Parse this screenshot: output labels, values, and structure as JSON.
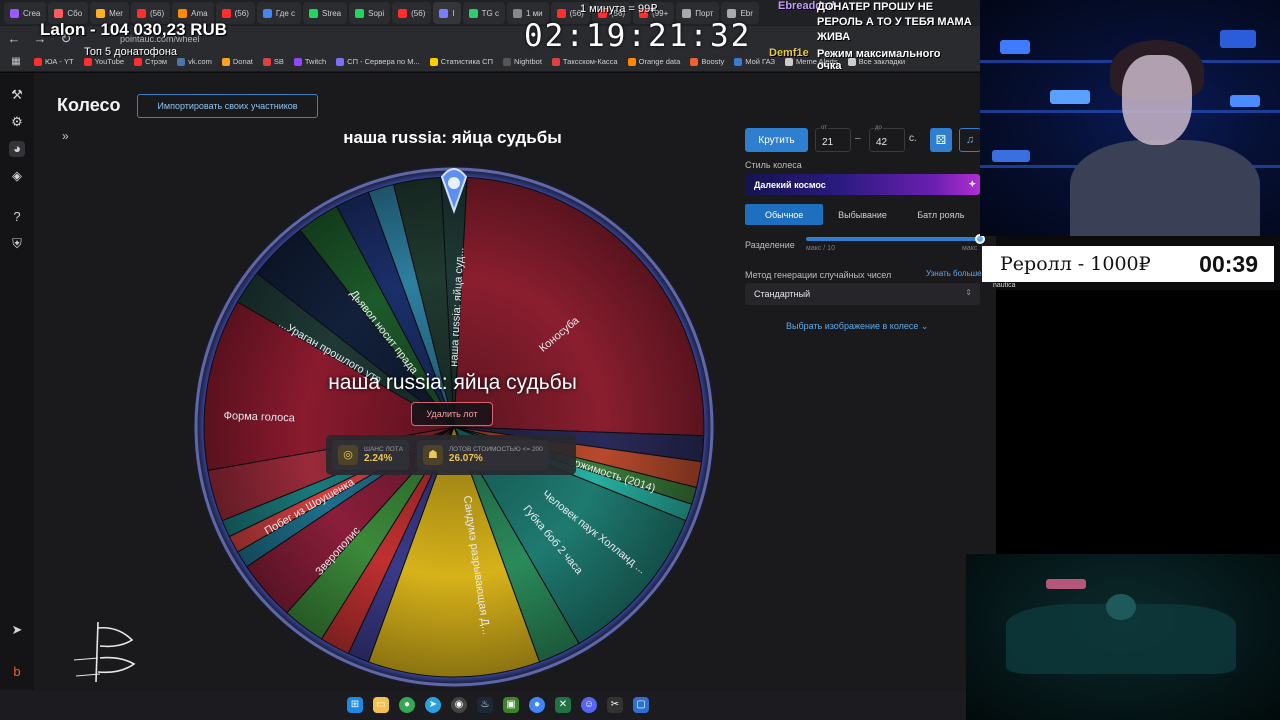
{
  "browser": {
    "tabs": [
      {
        "label": "Crea",
        "color": "#9b59ff"
      },
      {
        "label": "Сбо",
        "color": "#ff5a5a"
      },
      {
        "label": "Mer",
        "color": "#ffb020"
      },
      {
        "label": "(56)",
        "color": "#ff2d2d"
      },
      {
        "label": "Ama",
        "color": "#ff8a00"
      },
      {
        "label": "(56)",
        "color": "#ff2d2d"
      },
      {
        "label": "Где с",
        "color": "#4285f4"
      },
      {
        "label": "Strea",
        "color": "#1ed760"
      },
      {
        "label": "Sopi",
        "color": "#1ed760"
      },
      {
        "label": "(56)",
        "color": "#ff2d2d"
      },
      {
        "label": "I",
        "color": "#7c7cff"
      },
      {
        "label": "TG с",
        "color": "#2ecc71"
      },
      {
        "label": "1 ми",
        "color": "#888888"
      },
      {
        "label": "(56)",
        "color": "#ff2d2d"
      },
      {
        "label": "(56)",
        "color": "#ff2d2d"
      },
      {
        "label": "(99+",
        "color": "#ff2d2d"
      },
      {
        "label": "Порт",
        "color": "#aaaaaa"
      },
      {
        "label": "Ebr",
        "color": "#aaaaaa"
      }
    ],
    "url": "pointauc.com/wheel",
    "bookmarks": [
      {
        "label": "ЮА - YT",
        "color": "#ff2d2d"
      },
      {
        "label": "YouTube",
        "color": "#ff2d2d"
      },
      {
        "label": "Стрэм",
        "color": "#ff2d2d"
      },
      {
        "label": "vk.com",
        "color": "#4a76a8"
      },
      {
        "label": "Donat",
        "color": "#ff9f1c"
      },
      {
        "label": "SB",
        "color": "#e04040"
      },
      {
        "label": "Twitch",
        "color": "#9146ff"
      },
      {
        "label": "СП - Сервера по М...",
        "color": "#7a6fff"
      },
      {
        "label": "Статистика СП",
        "color": "#ffcc00"
      },
      {
        "label": "Nightbot",
        "color": "#555555"
      },
      {
        "label": "Таксском-Касса",
        "color": "#e04040"
      },
      {
        "label": "Orange data",
        "color": "#ff8a00"
      },
      {
        "label": "Boosty",
        "color": "#f15f2c"
      },
      {
        "label": "Мой ГАЗ",
        "color": "#3a7bd5"
      },
      {
        "label": "Meme Alerts",
        "color": "#cccccc"
      },
      {
        "label": "Все закладки",
        "color": "#cccccc"
      }
    ]
  },
  "page": {
    "title": "Колесо",
    "import_button": "Импортировать своих участников",
    "winner": "наша russia: яйца судьбы",
    "delete_button": "Удалить лот",
    "stats": [
      {
        "label": "ШАНС ЛОТА",
        "value": "2.24%",
        "icon": "target-icon"
      },
      {
        "label": "ЛОТОВ СТОИМОСТЬЮ <= 200",
        "value": "26.07%",
        "icon": "group-icon"
      }
    ],
    "wheel_labels": [
      "Коносуба",
      "наша russia: яйца суд...",
      "Дьявол носит прада",
      "...Ураган прошлого утр",
      "Форма голоса",
      "Побег из Шоушенка",
      "Зверополис",
      "Сандумэ разрывающая Д...",
      "Губка боб 2 часа",
      "Человек паук Холланд ...",
      "ержимость (2014)"
    ]
  },
  "controls": {
    "spin_button": "Крутить",
    "from_caption": "от",
    "from_value": "21",
    "to_caption": "до",
    "to_value": "42",
    "seconds_unit": "с.",
    "style_label": "Стиль колеса",
    "style_value": "Далекий космос",
    "modes": [
      "Обычное",
      "Выбывание",
      "Батл рояль"
    ],
    "active_mode": "Обычное",
    "division_label": "Разделение",
    "slider_min": "макс / 10",
    "slider_max": "макс",
    "slider_value": 1.0,
    "rng_label": "Метод генерации случайных чисел",
    "learn_more": "Узнать больше",
    "rng_value": "Стандартный",
    "choose_image": "Выбрать изображение в колесе"
  },
  "overlay": {
    "balance": "Lalon - 104 030,23 RUB",
    "top5": "Топ 5 донатофона",
    "timer": "02:19:21:32",
    "minute_price": "1 минута = 99₽",
    "donater_name": "Ebreadded",
    "donater_message": "ДОНАТЕР ПРОШУ НЕ РЕРОЛЬ А ТО У ТЕБЯ МАМА ЖИВА",
    "top_donor": "Demf1e",
    "mode_text": "Режим максимального очка",
    "reroll_label": "Реролл - 1000₽",
    "reroll_countdown": "00:39",
    "small_caption": "nautica"
  }
}
